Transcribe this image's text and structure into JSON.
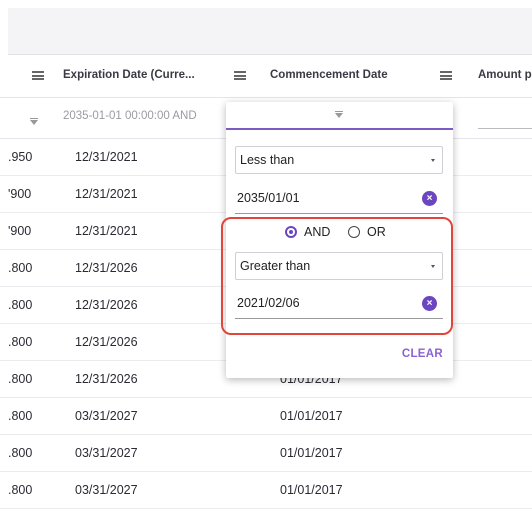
{
  "header": {
    "col1": "Expiration Date (Curre...",
    "col2": "Commencement Date",
    "col3": "Amount p"
  },
  "filter": {
    "expiration_filter_text": "2035-01-01 00:00:00 AND"
  },
  "rows": [
    {
      "amount": ".950",
      "expiration": "12/31/2021",
      "commencement": ""
    },
    {
      "amount": "'900",
      "expiration": "12/31/2021",
      "commencement": ""
    },
    {
      "amount": "'900",
      "expiration": "12/31/2021",
      "commencement": ""
    },
    {
      "amount": ".800",
      "expiration": "12/31/2026",
      "commencement": ""
    },
    {
      "amount": ".800",
      "expiration": "12/31/2026",
      "commencement": ""
    },
    {
      "amount": ".800",
      "expiration": "12/31/2026",
      "commencement": ""
    },
    {
      "amount": ".800",
      "expiration": "12/31/2026",
      "commencement": "01/01/2017"
    },
    {
      "amount": ".800",
      "expiration": "03/31/2027",
      "commencement": "01/01/2017"
    },
    {
      "amount": ".800",
      "expiration": "03/31/2027",
      "commencement": "01/01/2017"
    },
    {
      "amount": ".800",
      "expiration": "03/31/2027",
      "commencement": "01/01/2017"
    }
  ],
  "popup": {
    "condition1_type": "Less than",
    "condition1_value": "2035/01/01",
    "join_and": "AND",
    "join_or": "OR",
    "join_selected": "AND",
    "condition2_type": "Greater than",
    "condition2_value": "2021/02/06",
    "clear_label": "CLEAR",
    "clear_icon": "×"
  },
  "colors": {
    "accent": "#6b46c1",
    "highlight": "#e0463a"
  }
}
